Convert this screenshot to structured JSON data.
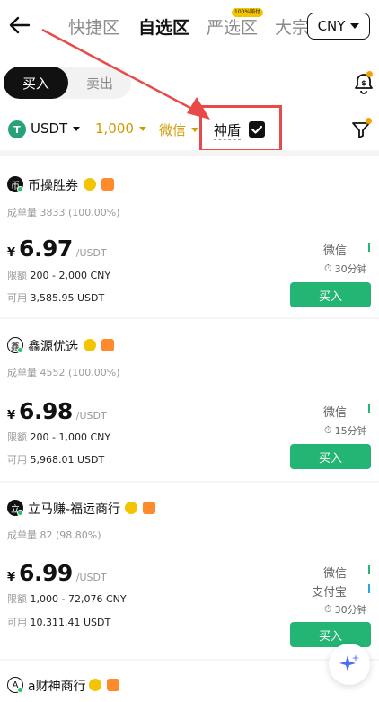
{
  "nav": {
    "tabs": [
      "快捷区",
      "自选区",
      "严选区",
      "大宗"
    ],
    "active_tab": "自选区",
    "badge": "100%赔付",
    "currency": "CNY"
  },
  "toggle": {
    "buy": "买入",
    "sell": "卖出"
  },
  "filters": {
    "coin": "USDT",
    "amount": "1,000",
    "payment": "微信",
    "shield": "神盾",
    "shield_checked": true
  },
  "colors": {
    "buy_green": "#22b573",
    "accent_gold": "#d19b00",
    "highlight_red": "#e84a4a"
  },
  "merchants": [
    {
      "avatar": "币",
      "name": "币操胜券",
      "orders": "成单量",
      "orders_value": "3833 (100.00%)",
      "currency_symbol": "¥",
      "price": "6.97",
      "unit": "/USDT",
      "limit_label": "限额",
      "limit": "200 - 2,000 CNY",
      "avail_label": "可用",
      "available": "3,585.95 USDT",
      "payments": [
        "微信"
      ],
      "time": "30分钟",
      "action": "买入"
    },
    {
      "avatar": "鑫",
      "name": "鑫源优选",
      "orders": "成单量",
      "orders_value": "4552 (100.00%)",
      "currency_symbol": "¥",
      "price": "6.98",
      "unit": "/USDT",
      "limit_label": "限额",
      "limit": "200 - 1,000 CNY",
      "avail_label": "可用",
      "available": "5,968.01 USDT",
      "payments": [
        "微信"
      ],
      "time": "15分钟",
      "action": "买入"
    },
    {
      "avatar": "立",
      "name": "立马赚-福运商行",
      "orders": "成单量",
      "orders_value": "82 (98.80%)",
      "currency_symbol": "¥",
      "price": "6.99",
      "unit": "/USDT",
      "limit_label": "限额",
      "limit": "1,000 - 72,076 CNY",
      "avail_label": "可用",
      "available": "10,311.41 USDT",
      "payments": [
        "微信",
        "支付宝"
      ],
      "time": "30分钟",
      "action": "买入"
    },
    {
      "avatar": "A",
      "name": "a财神商行"
    }
  ]
}
